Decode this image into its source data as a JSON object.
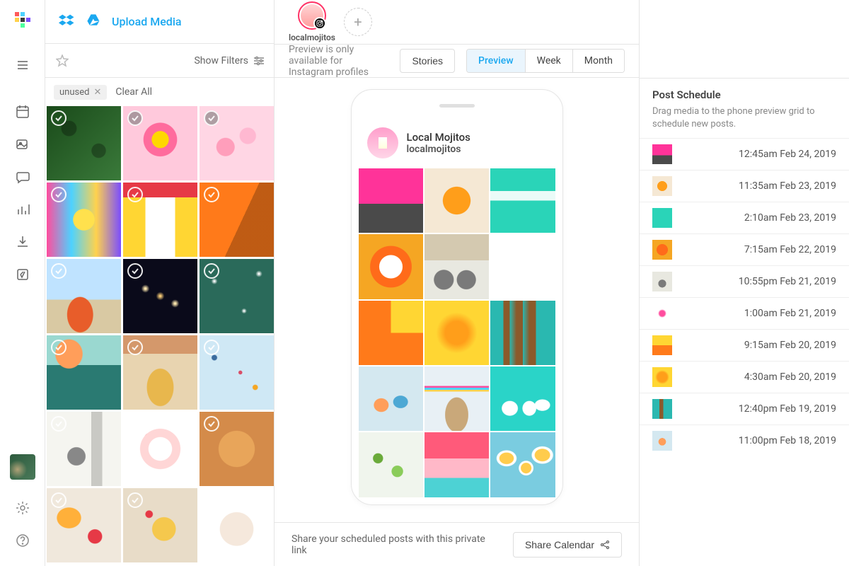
{
  "rail": {
    "nav_items": [
      "calendar",
      "media",
      "conversations",
      "analytics",
      "download",
      "link"
    ]
  },
  "library": {
    "upload_label": "Upload Media",
    "show_filters_label": "Show Filters",
    "tag": "unused",
    "clear_all_label": "Clear All",
    "media": [
      {
        "bg": "linear-gradient(135deg,#1a4a1a,#3a7a3a)",
        "pattern": "radial-gradient(circle at 30% 30%, rgba(0,0,0,0.3) 10%, transparent 11%),radial-gradient(circle at 70% 60%, rgba(0,0,0,0.3) 10%, transparent 11%)",
        "check": "outline"
      },
      {
        "bg": "#ffc9dc",
        "pattern": "radial-gradient(circle at 50% 45%, #ffd700 15%, #ff6b9d 16% 30%, transparent 31%)",
        "check": "filled"
      },
      {
        "bg": "#ffd6e4",
        "pattern": "radial-gradient(circle at 35% 55%, #ff9ebb 14%, transparent 15%),radial-gradient(circle at 65% 40%, #ffb8d1 12%, transparent 13%)",
        "check": "filled"
      },
      {
        "bg": "linear-gradient(90deg,#ff4d9e,#4dd2ff,#ffd24d,#7a4dff)",
        "pattern": "radial-gradient(circle at 50% 50%, #ffe14d 20%, transparent 21%)",
        "check": "outline"
      },
      {
        "bg": "#ffd633",
        "pattern": "linear-gradient(#e63946 0 20%, transparent 20%),linear-gradient(90deg, transparent 30%, #fff 30% 70%, transparent 70%)",
        "check": "outline"
      },
      {
        "bg": "#ff7a1a",
        "pattern": "linear-gradient(115deg, transparent 55%, rgba(0,0,0,0.25) 55%)",
        "check": "outline"
      },
      {
        "bg": "linear-gradient(#bfe3ff 0 55%,#d9c9a3 55%)",
        "pattern": "radial-gradient(ellipse at 45% 75%, #e85d2a 22%, transparent 23%)",
        "check": "outline"
      },
      {
        "bg": "#0a0a1a",
        "pattern": "radial-gradient(circle at 50% 50%, #ffd27a 1%, transparent 8%),radial-gradient(circle at 30% 40%, #ffe9b0 1%, transparent 6%),radial-gradient(circle at 70% 60%, #ffe9b0 1%, transparent 6%)",
        "check": "outline"
      },
      {
        "bg": "#2a6a5a",
        "pattern": "radial-gradient(circle at 20% 30%, #fff 0.5%, transparent 4%),radial-gradient(circle at 60% 70%, #fff 0.5%, transparent 4%),radial-gradient(circle at 80% 20%, #fff 0.5%, transparent 4%)",
        "check": "outline"
      },
      {
        "bg": "linear-gradient(#9ad8d0 0 40%,#2a7a72 40%)",
        "pattern": "radial-gradient(ellipse at 30% 25%, #ff9e5a 18%, transparent 19%)",
        "check": "outline"
      },
      {
        "bg": "#e8d4b0",
        "pattern": "linear-gradient(#d4986b 0 25%, transparent 25%),radial-gradient(ellipse at 50% 70%, #e8b74d 25%, transparent 26%)",
        "check": "outline"
      },
      {
        "bg": "#cfe8f5",
        "pattern": "radial-gradient(circle at 20% 30%,#3a6b9e 3%,transparent 4%),radial-gradient(circle at 55% 50%,#d94d66 3%,transparent 4%),radial-gradient(circle at 75% 70%,#f5a623 3%,transparent 4%)",
        "check": "outline"
      },
      {
        "bg": "#f5f5f0",
        "pattern": "radial-gradient(ellipse at 40% 60%, #888 14%, transparent 15%),linear-gradient(90deg,transparent 60%,#c9c9c4 60% 75%,transparent 75%)",
        "check": "outline"
      },
      {
        "bg": "#fff",
        "pattern": "radial-gradient(circle at 50% 50%, #fff 22%, #ffd6d6 23% 38%, transparent 39%),radial-gradient(circle at 35% 35%, #e63946 6%, transparent 7%),radial-gradient(circle at 65% 60%, #e63946 6%, transparent 7%)",
        "check": "outline"
      },
      {
        "bg": "#d48b4a",
        "pattern": "radial-gradient(circle at 50% 50%, #e8a55a 34%, transparent 35%)",
        "check": "outline"
      },
      {
        "bg": "#f0e8dc",
        "pattern": "radial-gradient(ellipse at 30% 40%, #ffb03a 16%, transparent 17%),radial-gradient(ellipse at 65% 65%, #e63946 10%, transparent 11%)",
        "check": "outline"
      },
      {
        "bg": "#e8dcc8",
        "pattern": "radial-gradient(ellipse at 55% 55%, #f5c84d 20%, transparent 21%),radial-gradient(circle at 35% 35%, #e63946 5%, transparent 6%)",
        "check": "outline"
      },
      {
        "bg": "#fff",
        "pattern": "radial-gradient(circle at 50% 55%, #f5e8dc 30%, transparent 31%),radial-gradient(circle at 48% 52%, #c77a4d 10%, transparent 11%)",
        "check": "outline"
      }
    ]
  },
  "center": {
    "profile_name": "localmojitos",
    "preview_note": "Preview is only available for Instagram profiles",
    "stories_label": "Stories",
    "view_tabs": [
      "Preview",
      "Week",
      "Month"
    ],
    "active_tab": "Preview",
    "ig_display_name": "Local Mojitos",
    "ig_handle": "localmojitos",
    "ig_grid": [
      {
        "bg": "linear-gradient(#ff3399 0 55%,#4a4a4a 55%)"
      },
      {
        "bg": "#f5e8d4",
        "pattern": "radial-gradient(ellipse at 50% 50%, #ff9e1a 30%, transparent 31%)"
      },
      {
        "bg": "#2ad4b8",
        "pattern": "linear-gradient(transparent 35%, rgba(255,255,255,0.9) 35% 50%, transparent 50%)"
      },
      {
        "bg": "#f5a623",
        "pattern": "radial-gradient(circle at 50% 50%, #fff 25%, #ff6b1a 26% 45%, transparent 46%)"
      },
      {
        "bg": "#e8e8e0",
        "pattern": "radial-gradient(circle at 30% 70%, #7a7a7a 15%, transparent 16%),radial-gradient(circle at 65% 70%, #7a7a7a 15%, transparent 16%)",
        "extra": "linear-gradient(#d4c9b0 0 40%, transparent 40%)"
      },
      {
        "bg": "#fff",
        "pattern": "radial-gradient(circle at 50% 50%, #fff 28%, transparent 29%),radial-gradient(circle at 42% 42%, #ff4d9e 6%, transparent 7%),radial-gradient(circle at 58% 58%, #4dff9e 6%, transparent 7%)"
      },
      {
        "bg": "linear-gradient(#ffd633 0 50%,#ff7a1a 50%)",
        "pattern": "linear-gradient(90deg,#ff7a1a 0 50%, transparent 50%)"
      },
      {
        "bg": "#ffd633",
        "pattern": "radial-gradient(ellipse at 50% 50%, #ff9e1a 25% , transparent 45%)"
      },
      {
        "bg": "#2ab8b0",
        "pattern": "linear-gradient(90deg,transparent 20%,#8b5a2b 20% 30%,transparent 30%,#8b5a2b 40% 50%,transparent 50%,#8b5a2b 60% 70%,transparent 70%)"
      },
      {
        "bg": "#d4e8f0",
        "pattern": "radial-gradient(ellipse at 35% 60%, #ff9e5a 12%, transparent 13%),radial-gradient(ellipse at 65% 55%, #4da8d4 12%, transparent 13%)"
      },
      {
        "bg": "#e8f0f5",
        "pattern": "linear-gradient(transparent 30%,#ff4d9e 30% 33%,#4dd2ff 33% 36%,#ffd24d 36% 39%,transparent 39%),radial-gradient(ellipse at 50% 75%,#c9a87a 25%,transparent 26%)"
      },
      {
        "bg": "#2ad4c8",
        "pattern": "radial-gradient(ellipse at 30% 65%, #fff 12%, transparent 13%),radial-gradient(ellipse at 60% 65%, #fff 12%, transparent 13%),radial-gradient(ellipse at 80% 60%, #fff 10%, transparent 11%)"
      },
      {
        "bg": "#f0f5ed",
        "pattern": "radial-gradient(circle at 30% 40%,#6aaa3a 8%,transparent 9%),radial-gradient(circle at 60% 60%,#8acc5a 10%,transparent 11%)"
      },
      {
        "bg": "linear-gradient(#ff5a7a 0 40%,#ffb8c8 40% 70%,#4dd2d4 70%)"
      },
      {
        "bg": "#7acce0",
        "pattern": "radial-gradient(ellipse at 25% 40%,#ffcc4d 10%,#fff 11% 14%,transparent 15%),radial-gradient(ellipse at 55% 55%,#ffcc4d 10%,#fff 11% 14%,transparent 15%),radial-gradient(ellipse at 80% 35%,#ffcc4d 10%,#fff 11% 14%,transparent 15%)"
      }
    ],
    "share_text": "Share your scheduled posts with this private link",
    "share_button_label": "Share Calendar"
  },
  "schedule": {
    "title": "Post Schedule",
    "hint": "Drag media to the phone preview grid to schedule new posts.",
    "items": [
      {
        "time": "12:45am Feb 24, 2019",
        "thumb": {
          "bg": "linear-gradient(#ff3399 0 55%,#4a4a4a 55%)"
        }
      },
      {
        "time": "11:35am Feb 23, 2019",
        "thumb": {
          "bg": "#f5e8d4",
          "pattern": "radial-gradient(circle at 50% 50%,#ff9e1a 35%,transparent 36%)"
        }
      },
      {
        "time": "2:10am Feb 23, 2019",
        "thumb": {
          "bg": "#2ad4b8"
        }
      },
      {
        "time": "7:15am Feb 22, 2019",
        "thumb": {
          "bg": "#f5a623",
          "pattern": "radial-gradient(circle at 50% 50%,#ff6b1a 40%,transparent 41%)"
        }
      },
      {
        "time": "10:55pm Feb 21, 2019",
        "thumb": {
          "bg": "#e8e8e0",
          "pattern": "radial-gradient(circle at 50% 60%,#7a7a7a 25%,transparent 26%)"
        }
      },
      {
        "time": "1:00am Feb 21, 2019",
        "thumb": {
          "bg": "#fff",
          "pattern": "radial-gradient(circle at 50% 50%,#ff4d9e 20%,transparent 30%)"
        }
      },
      {
        "time": "9:15am Feb 20, 2019",
        "thumb": {
          "bg": "#ff7a1a",
          "pattern": "linear-gradient(#ffd633 0 50%,transparent 50%)"
        }
      },
      {
        "time": "4:30am Feb 20, 2019",
        "thumb": {
          "bg": "#ffd633",
          "pattern": "radial-gradient(ellipse at 50% 50%,#ff9e1a 35%,transparent 50%)"
        }
      },
      {
        "time": "12:40pm Feb 19, 2019",
        "thumb": {
          "bg": "#2ab8b0",
          "pattern": "linear-gradient(90deg,transparent 35%,#8b5a2b 35% 55%,transparent 55%)"
        }
      },
      {
        "time": "11:00pm Feb 18, 2019",
        "thumb": {
          "bg": "#d4e8f0",
          "pattern": "radial-gradient(circle at 50% 55%,#ff9e5a 25%,transparent 26%)"
        }
      }
    ]
  }
}
